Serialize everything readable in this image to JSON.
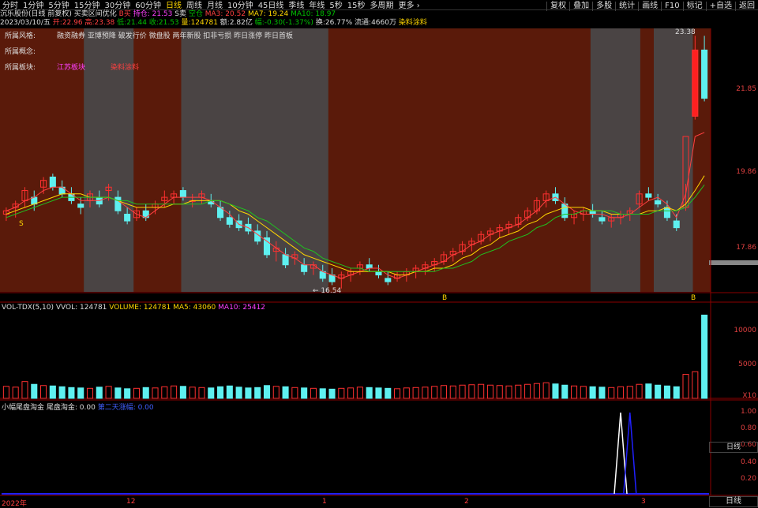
{
  "toolbar": {
    "tabs": [
      "分时",
      "1分钟",
      "5分钟",
      "15分钟",
      "30分钟",
      "60分钟",
      "日线",
      "周线",
      "月线",
      "10分钟",
      "45日线",
      "季线",
      "年线",
      "5秒",
      "15秒",
      "多周期",
      "更多 ›"
    ],
    "active_index": 6,
    "right_buttons": [
      "复权",
      "叠加",
      "多股",
      "统计",
      "画线",
      "F10",
      "标记",
      "+自选",
      "返回"
    ]
  },
  "info": {
    "stock": "沉乐股份(日线 前复权)",
    "formula": "买卖区间优化",
    "sell_label": "B买",
    "hold_label": "持仓: 21.53",
    "s_sell": "S卖",
    "empty_pos": "空仓",
    "ma3": "MA3: 20.52",
    "ma7": "MA7: 19.24",
    "ma10": "MA10: 18.97",
    "date": "2023/03/10/五",
    "open": "开:22.96",
    "high": "高:23.38",
    "low": "低:21.44",
    "close": "收:21.53",
    "volume": "量:124781",
    "amount": "额:2.82亿",
    "change": "幅:-0.30(-1.37%)",
    "turnover": "换:26.77%",
    "float": "流通:4660万",
    "source": "染料涂料"
  },
  "tags": {
    "style_label": "所属风格:",
    "style_value": "融资融券 亚博预降 破发行价 微盘股 两年新股 扣非亏损 昨日涨停 昨日首板",
    "concept_label": "所属概念:",
    "sector_label": "所属板块:",
    "sector_value": "江苏板块",
    "sector_extra": "染料涂料"
  },
  "price_axis": [
    "23.38",
    "21.85",
    "19.86",
    "17.86"
  ],
  "price_markers": {
    "high_label": "23.38",
    "low_label": "← 16.54",
    "buy_marker_1": "B",
    "buy_marker_2": "B",
    "sell_marker": "S"
  },
  "vol_panel": {
    "title": "VOL-TDX(5,10)",
    "vvol": "VVOL: 124781",
    "volume": "VOLUME: 124781",
    "ma5": "MA5: 43060",
    "ma10": "MA10: 25412",
    "axis": [
      "10000",
      "5000"
    ],
    "unit": "X10"
  },
  "ind_panel": {
    "title": "小幅尾盘淘金",
    "label": "尾盘淘金: 0.00",
    "label2": "第二天涨幅: 0.00",
    "axis": [
      "1.00",
      "0.80",
      "0.60",
      "0.40",
      "0.20"
    ]
  },
  "dates": {
    "y2022": "2022年",
    "d12": "12",
    "d1": "1",
    "d2": "2",
    "d3": "3"
  },
  "side_labels": {
    "top": "日线",
    "bottom": "日线"
  },
  "chart_data": {
    "type": "candlestick",
    "candles": [
      [
        18.1,
        18.3,
        17.9,
        18.2
      ],
      [
        18.3,
        18.5,
        18.0,
        18.4
      ],
      [
        18.5,
        18.9,
        18.3,
        18.8
      ],
      [
        18.6,
        18.8,
        18.2,
        18.4
      ],
      [
        18.9,
        19.2,
        18.7,
        19.1
      ],
      [
        19.2,
        19.3,
        18.8,
        18.9
      ],
      [
        18.9,
        19.1,
        18.6,
        18.7
      ],
      [
        18.7,
        18.9,
        18.4,
        18.5
      ],
      [
        18.4,
        18.6,
        18.1,
        18.3
      ],
      [
        18.5,
        18.8,
        18.3,
        18.7
      ],
      [
        18.6,
        18.8,
        18.3,
        18.4
      ],
      [
        18.8,
        19.0,
        18.5,
        18.9
      ],
      [
        18.6,
        18.8,
        18.1,
        18.2
      ],
      [
        18.1,
        18.3,
        17.8,
        17.9
      ],
      [
        18.0,
        18.3,
        17.9,
        18.2
      ],
      [
        18.2,
        18.4,
        17.9,
        18.0
      ],
      [
        18.3,
        18.5,
        18.1,
        18.4
      ],
      [
        18.5,
        18.8,
        18.3,
        18.6
      ],
      [
        18.6,
        18.8,
        18.4,
        18.7
      ],
      [
        18.8,
        18.9,
        18.5,
        18.6
      ],
      [
        18.5,
        18.7,
        18.3,
        18.5
      ],
      [
        18.6,
        18.8,
        18.4,
        18.7
      ],
      [
        18.5,
        18.7,
        18.3,
        18.4
      ],
      [
        18.3,
        18.5,
        17.9,
        18.0
      ],
      [
        18.0,
        18.2,
        17.7,
        17.8
      ],
      [
        17.9,
        18.1,
        17.6,
        17.7
      ],
      [
        17.8,
        18.0,
        17.5,
        17.6
      ],
      [
        17.6,
        17.8,
        17.2,
        17.3
      ],
      [
        17.4,
        17.6,
        16.8,
        16.9
      ],
      [
        17.0,
        17.3,
        16.7,
        17.1
      ],
      [
        16.9,
        17.1,
        16.5,
        16.6
      ],
      [
        16.8,
        17.0,
        16.6,
        16.9
      ],
      [
        16.6,
        16.8,
        16.3,
        16.4
      ],
      [
        16.5,
        16.7,
        16.3,
        16.6
      ],
      [
        16.4,
        16.6,
        16.1,
        16.2
      ],
      [
        16.3,
        16.5,
        16.0,
        16.1
      ],
      [
        16.2,
        16.4,
        15.9,
        16.3
      ],
      [
        16.3,
        16.5,
        16.1,
        16.4
      ],
      [
        16.5,
        16.7,
        16.3,
        16.6
      ],
      [
        16.6,
        16.8,
        16.4,
        16.5
      ],
      [
        16.4,
        16.6,
        16.2,
        16.3
      ],
      [
        16.2,
        16.4,
        16.0,
        16.1
      ],
      [
        16.2,
        16.4,
        16.1,
        16.3
      ],
      [
        16.3,
        16.5,
        16.1,
        16.4
      ],
      [
        16.4,
        16.6,
        16.2,
        16.5
      ],
      [
        16.5,
        16.7,
        16.3,
        16.6
      ],
      [
        16.6,
        16.8,
        16.4,
        16.7
      ],
      [
        16.7,
        17.0,
        16.6,
        16.9
      ],
      [
        16.9,
        17.1,
        16.7,
        17.0
      ],
      [
        17.0,
        17.3,
        16.9,
        17.2
      ],
      [
        17.2,
        17.4,
        17.0,
        17.3
      ],
      [
        17.3,
        17.6,
        17.2,
        17.5
      ],
      [
        17.5,
        17.7,
        17.3,
        17.6
      ],
      [
        17.6,
        17.8,
        17.4,
        17.7
      ],
      [
        17.7,
        17.9,
        17.5,
        17.8
      ],
      [
        17.8,
        18.1,
        17.7,
        18.0
      ],
      [
        18.0,
        18.3,
        17.9,
        18.2
      ],
      [
        18.2,
        18.6,
        18.1,
        18.5
      ],
      [
        18.5,
        18.8,
        18.3,
        18.7
      ],
      [
        18.7,
        18.9,
        18.4,
        18.5
      ],
      [
        18.4,
        18.6,
        17.9,
        18.0
      ],
      [
        18.0,
        18.2,
        17.8,
        18.1
      ],
      [
        18.1,
        18.3,
        17.9,
        18.2
      ],
      [
        18.2,
        18.4,
        18.0,
        18.1
      ],
      [
        18.0,
        18.2,
        17.8,
        17.9
      ],
      [
        17.9,
        18.1,
        17.7,
        18.0
      ],
      [
        18.0,
        18.2,
        17.8,
        18.1
      ],
      [
        18.1,
        18.3,
        17.9,
        18.2
      ],
      [
        18.4,
        18.8,
        18.3,
        18.7
      ],
      [
        18.7,
        18.9,
        18.5,
        18.6
      ],
      [
        18.5,
        18.7,
        18.3,
        18.4
      ],
      [
        18.3,
        18.5,
        17.9,
        18.0
      ],
      [
        17.9,
        18.1,
        17.6,
        17.7
      ],
      [
        18.3,
        19.0,
        18.2,
        20.4
      ],
      [
        21.0,
        23.38,
        20.9,
        22.96
      ],
      [
        22.96,
        23.38,
        21.44,
        21.53
      ]
    ],
    "ma3": [
      18.2,
      18.3,
      18.5,
      18.6,
      18.8,
      18.9,
      18.9,
      18.7,
      18.5,
      18.5,
      18.5,
      18.6,
      18.5,
      18.3,
      18.1,
      18.0,
      18.2,
      18.4,
      18.6,
      18.6,
      18.6,
      18.6,
      18.5,
      18.3,
      18.1,
      17.8,
      17.7,
      17.5,
      17.3,
      17.1,
      16.9,
      16.8,
      16.6,
      16.6,
      16.4,
      16.3,
      16.2,
      16.3,
      16.4,
      16.5,
      16.5,
      16.3,
      16.2,
      16.3,
      16.4,
      16.5,
      16.6,
      16.7,
      16.9,
      17.0,
      17.2,
      17.3,
      17.5,
      17.6,
      17.7,
      17.8,
      18.0,
      18.2,
      18.5,
      18.6,
      18.4,
      18.2,
      18.1,
      18.1,
      18.1,
      18.0,
      18.0,
      18.1,
      18.3,
      18.5,
      18.6,
      18.4,
      18.0,
      18.7,
      20.4,
      20.52
    ],
    "ma7": [
      18.1,
      18.2,
      18.3,
      18.4,
      18.5,
      18.6,
      18.7,
      18.7,
      18.7,
      18.6,
      18.6,
      18.6,
      18.5,
      18.4,
      18.3,
      18.3,
      18.3,
      18.3,
      18.4,
      18.4,
      18.5,
      18.5,
      18.5,
      18.5,
      18.4,
      18.2,
      18.1,
      17.9,
      17.7,
      17.5,
      17.3,
      17.1,
      16.9,
      16.8,
      16.7,
      16.6,
      16.5,
      16.4,
      16.4,
      16.4,
      16.4,
      16.4,
      16.3,
      16.3,
      16.4,
      16.4,
      16.5,
      16.5,
      16.6,
      16.8,
      16.9,
      17.1,
      17.2,
      17.4,
      17.5,
      17.6,
      17.8,
      17.9,
      18.1,
      18.2,
      18.3,
      18.3,
      18.3,
      18.2,
      18.2,
      18.1,
      18.1,
      18.1,
      18.1,
      18.2,
      18.2,
      18.3,
      18.2,
      18.4,
      18.8,
      19.24
    ],
    "ma10": [
      18.0,
      18.1,
      18.2,
      18.3,
      18.4,
      18.5,
      18.6,
      18.6,
      18.6,
      18.6,
      18.6,
      18.6,
      18.5,
      18.5,
      18.4,
      18.4,
      18.4,
      18.4,
      18.4,
      18.4,
      18.4,
      18.4,
      18.5,
      18.5,
      18.4,
      18.3,
      18.2,
      18.0,
      17.9,
      17.7,
      17.5,
      17.3,
      17.1,
      17.0,
      16.8,
      16.7,
      16.6,
      16.5,
      16.5,
      16.4,
      16.4,
      16.4,
      16.4,
      16.4,
      16.4,
      16.4,
      16.4,
      16.5,
      16.5,
      16.6,
      16.7,
      16.9,
      17.0,
      17.1,
      17.3,
      17.4,
      17.5,
      17.7,
      17.8,
      18.0,
      18.1,
      18.1,
      18.2,
      18.2,
      18.2,
      18.2,
      18.1,
      18.1,
      18.1,
      18.1,
      18.2,
      18.2,
      18.2,
      18.3,
      18.6,
      18.97
    ],
    "volumes": [
      3000,
      2800,
      4200,
      3500,
      3200,
      3100,
      2900,
      2700,
      2600,
      2500,
      2800,
      3000,
      2600,
      2400,
      2500,
      2700,
      2600,
      2900,
      3100,
      3000,
      2800,
      2700,
      2600,
      2900,
      3100,
      2800,
      2600,
      2700,
      3200,
      3000,
      2900,
      2700,
      2600,
      2500,
      2400,
      2300,
      2500,
      2600,
      2800,
      2700,
      2600,
      2500,
      2400,
      2600,
      2700,
      2800,
      3000,
      3200,
      3100,
      3300,
      3400,
      3500,
      3300,
      3200,
      3100,
      3300,
      3500,
      3700,
      3900,
      3600,
      3300,
      3100,
      3000,
      2900,
      2800,
      2700,
      2900,
      3000,
      3500,
      3600,
      3300,
      3100,
      2900,
      6000,
      40000,
      124781
    ],
    "ind_peaks": [
      {
        "index": 66,
        "series": "white"
      },
      {
        "index": 67,
        "series": "blue"
      }
    ],
    "ylim": [
      15.8,
      23.6
    ],
    "xlabels": [
      "2022年",
      "12",
      "1",
      "2",
      "3"
    ]
  }
}
